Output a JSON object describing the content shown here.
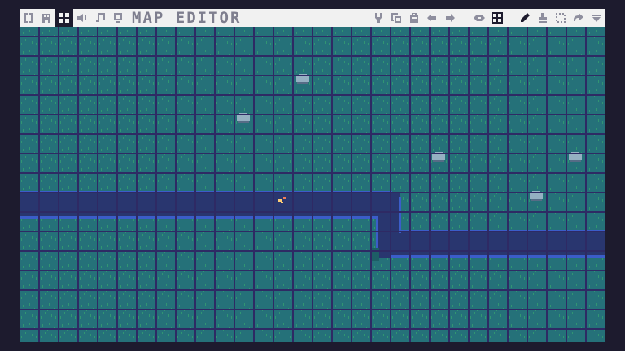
{
  "editor": {
    "title": "MAP EDITOR",
    "active_tab": "map"
  },
  "tabs": [
    {
      "name": "code-tab-icon",
      "active": false
    },
    {
      "name": "sprite-tab-icon",
      "active": false
    },
    {
      "name": "map-tab-icon",
      "active": true
    },
    {
      "name": "sfx-tab-icon",
      "active": false
    },
    {
      "name": "music-tab-icon",
      "active": false
    },
    {
      "name": "screen-tab-icon",
      "active": false
    }
  ],
  "tools": {
    "left": [
      "cut-icon",
      "copy-icon",
      "paste-icon",
      "undo-icon",
      "redo-icon"
    ],
    "view": [
      "eye-icon",
      "grid-toggle-icon"
    ],
    "right": [
      "pencil-icon",
      "stamp-icon",
      "select-icon",
      "shift-icon",
      "menu-arrow-icon"
    ]
  },
  "colors": {
    "background": "#1d1b2e",
    "toolbar": "#f1f1f1",
    "icon": "#8e8e9e",
    "grass": "#257179",
    "grass_blade": "#3cb36e",
    "river": "#29366f",
    "river_edge": "#3b5dc9",
    "grid": "#2e2a64",
    "rock": "#94b0c2",
    "fish": "#ffcd75"
  }
}
